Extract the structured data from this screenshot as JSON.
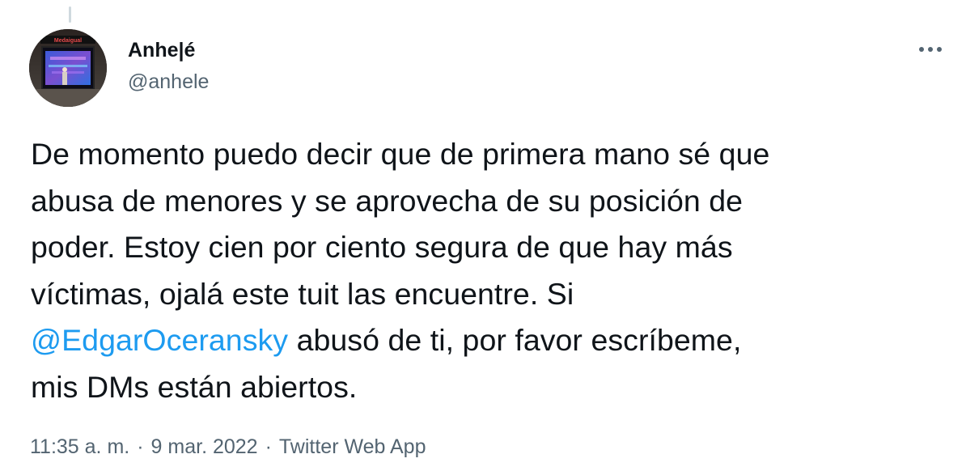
{
  "author": {
    "display_name": "Anhe|é",
    "handle": "@anhele",
    "avatar_sign_text": "Medaigual"
  },
  "more_icon": "more-horizontal-icon",
  "tweet": {
    "text_part1": "De momento puedo decir que de primera mano sé que\nabusa de menores y se aprovecha de su posición de\npoder. Estoy cien por ciento segura de que hay más\nvíctimas, ojalá este tuit las encuentre. Si\n",
    "mention": "@EdgarOceransky",
    "text_part2": " abusó de ti, por favor escríbeme,\nmis DMs están abiertos."
  },
  "meta": {
    "time": "11:35 a. m.",
    "separator": "·",
    "date": "9 mar. 2022",
    "source": "Twitter Web App"
  },
  "colors": {
    "link": "#1d9bf0",
    "secondary_text": "#536471",
    "primary_text": "#0f1419"
  }
}
